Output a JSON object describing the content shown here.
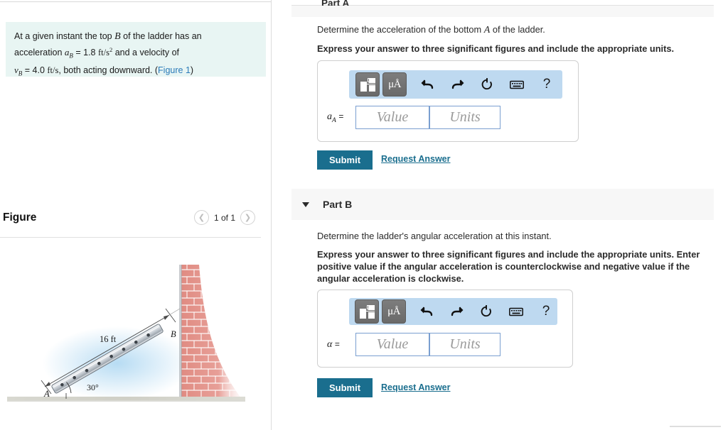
{
  "left": {
    "problem": {
      "line1_a": "At a given instant the top ",
      "var_B": "B",
      "line1_b": " of the ladder has an",
      "line2_a": "acceleration ",
      "var_aB": "a",
      "var_aB_sub": "B",
      "line2_eq": " = 1.8 ",
      "units_accel": "ft/s",
      "units_accel_sup": "2",
      "line2_b": " and a velocity of",
      "var_vB": "v",
      "var_vB_sub": "B",
      "line3_eq": " = 4.0 ",
      "units_vel": "ft/s",
      "line3_b": ", both acting downward. (",
      "figure_link": "Figure 1",
      "line3_c": ")"
    },
    "figure": {
      "title": "Figure",
      "prev_icon": "chevron-left-icon",
      "next_icon": "chevron-right-icon",
      "counter": "1 of 1",
      "labels": {
        "length": "16 ft",
        "angle": "30°",
        "point_a": "A",
        "point_b": "B"
      }
    }
  },
  "right": {
    "part_a": {
      "header_label": "Part A",
      "caret_icon": "caret-down-icon",
      "question": "Determine the acceleration of the bottom A of the ladder.",
      "question_pre": "Determine the acceleration of the bottom ",
      "question_var": "A",
      "question_post": " of the ladder.",
      "instruction": "Express your answer to three significant figures and include the appropriate units.",
      "toolbar": {
        "template_icon": "math-template-icon",
        "units_icon": "mu-angstrom-units-icon",
        "undo_icon": "undo-icon",
        "redo_icon": "redo-icon",
        "reset_icon": "reset-icon",
        "keyboard_icon": "keyboard-icon",
        "help_icon": "help-question-icon",
        "help_label": "?",
        "units_label": "μÅ"
      },
      "answer": {
        "symbol": "a",
        "symbol_sub": "A",
        "equals": "=",
        "value_placeholder": "Value",
        "units_placeholder": "Units"
      },
      "submit_label": "Submit",
      "request_answer_label": "Request Answer"
    },
    "part_b": {
      "header_label": "Part B",
      "caret_icon": "caret-down-icon",
      "question": "Determine the ladder's angular acceleration at this instant.",
      "instruction": "Express your answer to three significant figures and include the appropriate units. Enter positive value if the angular acceleration is counterclockwise and negative value if the angular acceleration is clockwise.",
      "toolbar": {
        "template_icon": "math-template-icon",
        "units_icon": "mu-angstrom-units-icon",
        "undo_icon": "undo-icon",
        "redo_icon": "redo-icon",
        "reset_icon": "reset-icon",
        "keyboard_icon": "keyboard-icon",
        "help_icon": "help-question-icon",
        "help_label": "?",
        "units_label": "μÅ"
      },
      "answer": {
        "symbol": "α",
        "equals": "=",
        "value_placeholder": "Value",
        "units_placeholder": "Units"
      },
      "submit_label": "Submit",
      "request_answer_label": "Request Answer"
    }
  },
  "colors": {
    "problem_box_bg": "#e8f5f3",
    "accent_teal": "#1a6e8e",
    "toolbar_blue": "#bed9f0",
    "link_blue": "#2b7bb9",
    "part_bar_bg": "#f7f7f7",
    "brick_red": "#e08b82"
  }
}
